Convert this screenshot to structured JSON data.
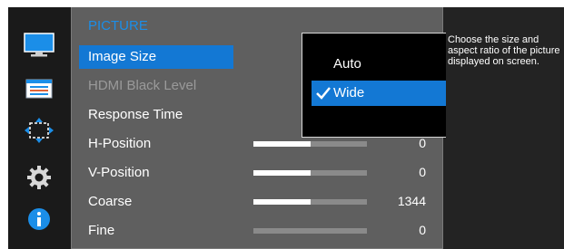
{
  "menu": {
    "title": "PICTURE",
    "items": [
      {
        "label": "Image Size"
      },
      {
        "label": "HDMI Black Level"
      },
      {
        "label": "Response Time"
      },
      {
        "label": "H-Position",
        "value": "0",
        "level": 0.5
      },
      {
        "label": "V-Position",
        "value": "0",
        "level": 0.5
      },
      {
        "label": "Coarse",
        "value": "1344",
        "level": 0.5
      },
      {
        "label": "Fine",
        "value": "0",
        "level": 0.0
      }
    ]
  },
  "dropdown": {
    "options": [
      "Auto",
      "Wide"
    ],
    "selected": "Wide"
  },
  "help": {
    "text": "Choose the size and aspect ratio of the picture displayed on screen."
  },
  "icons": [
    "monitor-icon",
    "picture-settings-icon",
    "position-arrows-icon",
    "gear-icon",
    "info-icon"
  ],
  "colors": {
    "accent": "#1378d4",
    "title_blue": "#1b8ee8",
    "menu_bg": "#5f5f5f",
    "dark_bg": "#232323"
  }
}
